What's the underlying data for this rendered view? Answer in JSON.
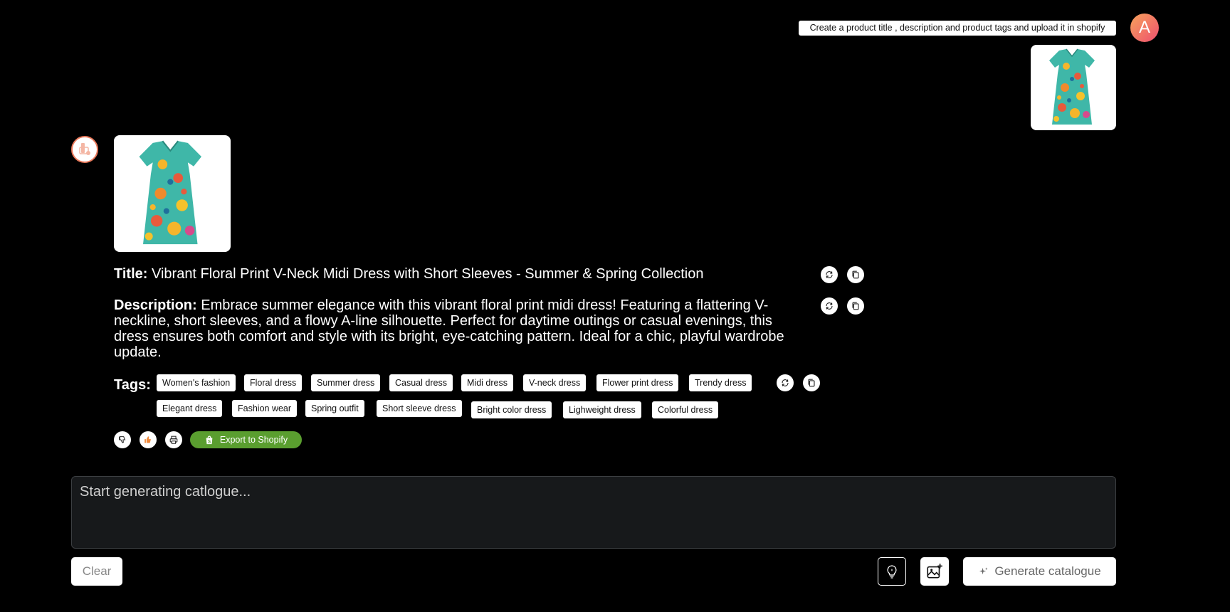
{
  "prompt": {
    "text": "Create a product title , description and product tags and upload it in shopify",
    "avatar_initial": "A"
  },
  "result": {
    "title_label": "Title:",
    "title_value": "Vibrant Floral Print V-Neck Midi Dress with Short Sleeves - Summer & Spring Collection",
    "description_label": "Description:",
    "description_value": "Embrace summer elegance with this vibrant floral print midi dress! Featuring a flattering V-neckline, short sleeves, and a flowy A-line silhouette. Perfect for daytime outings or casual evenings, this dress ensures both comfort and style with its bright, eye-catching pattern. Ideal for a chic, playful wardrobe update.",
    "tags_label": "Tags:",
    "tags": [
      "Women's fashion",
      "Floral dress",
      "Summer dress",
      "Casual dress",
      "Midi dress",
      "V-neck dress",
      "Flower print dress",
      "Trendy dress",
      "Elegant dress",
      "Fashion wear",
      "Spring outfit",
      "Short sleeve dress",
      "Bright color dress",
      "Lighweight dress",
      "Colorful dress"
    ],
    "export_label": "Export to Shopify"
  },
  "composer": {
    "placeholder": "Start generating catlogue...",
    "clear_label": "Clear",
    "generate_label": "Generate catalogue"
  },
  "colors": {
    "background": "#000000",
    "shopify_green": "#5a9e2f",
    "avatar_gradient": [
      "#f7a35c",
      "#ee4f6e"
    ],
    "bot_avatar_ring": "#e9785a",
    "thumbs_up": "#f08a3c"
  },
  "icons": {
    "refresh": "refresh-icon",
    "copy": "copy-icon",
    "thumbs_down": "thumbs-down-icon",
    "thumbs_up": "thumbs-up-icon",
    "print": "print-icon",
    "shopify": "shopify-bag-icon",
    "idea": "lightbulb-icon",
    "image_upload": "image-add-icon",
    "sparkle": "sparkle-icon"
  }
}
